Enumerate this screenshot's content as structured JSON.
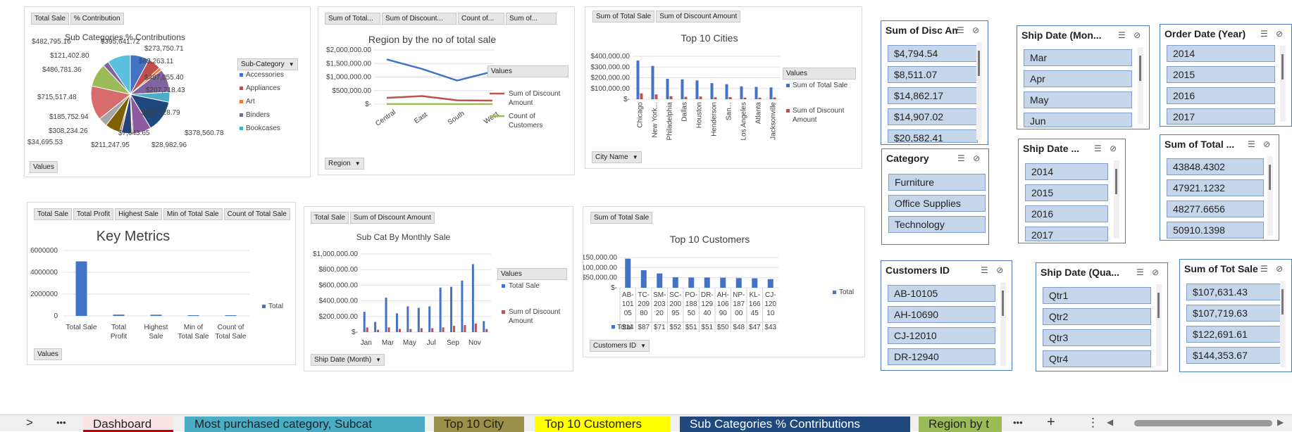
{
  "pie": {
    "buttons": [
      "Total Sale",
      "% Contribution"
    ],
    "title": "Sub Categories % Contributions",
    "legend_header": "Sub-Category",
    "legend": [
      "Accessories",
      "Appliances",
      "Art",
      "Binders",
      "Bookcases"
    ],
    "values_button": "Values",
    "labels": [
      "$482,795.16",
      "$395,641.72",
      "$273,750.71",
      "$121,402.80",
      "$63,263.11",
      "$486,781.36",
      "$487,055.40",
      "$207,718.43",
      "$715,517.48",
      "$662,428.79",
      "$185,752.94",
      "$308,234.26",
      "$7,643.65",
      "$378,560.78",
      "$34,695.53",
      "$211,247.95",
      "$28,982.96"
    ]
  },
  "region": {
    "buttons": [
      "Sum of Total...",
      "Sum of Discount...",
      "Count of...",
      "Sum of..."
    ],
    "title": "Region by the no of total sale",
    "legend_header": "Values",
    "axis_button": "Region",
    "legend": [
      "Sum of Total Sale",
      "Sum of Discount Amount",
      "Count of Customers"
    ]
  },
  "cities": {
    "buttons": [
      "Sum of Total Sale",
      "Sum of Discount Amount"
    ],
    "title": "Top 10 Cities",
    "legend_header": "Values",
    "axis_button": "City Name",
    "legend": [
      "Sum of Total Sale",
      "Sum of Discount Amount"
    ]
  },
  "metrics": {
    "buttons": [
      "Total Sale",
      "Total Profit",
      "Highest Sale",
      "Min of Total Sale",
      "Count of Total Sale"
    ],
    "title": "Key Metrics",
    "legend": "Total",
    "values_button": "Values"
  },
  "monthly": {
    "buttons": [
      "Total Sale",
      "Sum of Discount Amount"
    ],
    "title": "Sub Cat By Monthly Sale",
    "legend_header": "Values",
    "axis_button": "Ship Date (Month)",
    "legend": [
      "Total Sale",
      "Sum of Discount Amount"
    ]
  },
  "customers": {
    "buttons": [
      "Sum of Total  Sale"
    ],
    "title": "Top 10 Customers",
    "legend": "Total",
    "axis_button": "Customers ID",
    "table_label": "Total"
  },
  "chart_data": [
    {
      "type": "pie",
      "title": "Sub Categories % Contributions",
      "legend": [
        "Accessories",
        "Appliances",
        "Art",
        "Binders",
        "Bookcases"
      ],
      "values": [
        395641.72,
        273750.71,
        63263.11,
        487055.4,
        207718.43,
        662428.79,
        378560.78,
        28982.96,
        211247.95,
        7643.65,
        34695.53,
        308234.26,
        185752.94,
        715517.48,
        486781.36,
        121402.8,
        482795.16
      ],
      "colors": [
        "#4472c4",
        "#c0504d",
        "#ed7d31",
        "#8064a2",
        "#4bacc6",
        "#1f497d",
        "#8e5aa2",
        "#e46c0a",
        "#264478",
        "#ffc000",
        "#9b2335",
        "#7f6000",
        "#a5a5a5",
        "#d86c6c",
        "#9bbb59",
        "#8064a2",
        "#5bc0de"
      ]
    },
    {
      "type": "line",
      "title": "Region by the no of total sale",
      "categories": [
        "Central",
        "East",
        "South",
        "West"
      ],
      "ylim": [
        0,
        2000000
      ],
      "yticks": [
        "$2,000,000.00",
        "$1,500,000.00",
        "$1,000,000.00",
        "$500,000.00",
        "$-"
      ],
      "series": [
        {
          "name": "Sum of Total Sale",
          "color": "#4472c4",
          "values": [
            1650000,
            1300000,
            870000,
            1200000
          ]
        },
        {
          "name": "Sum of Discount Amount",
          "color": "#c0504d",
          "values": [
            230000,
            300000,
            140000,
            130000
          ]
        },
        {
          "name": "Count of Customers",
          "color": "#9bbb59",
          "values": [
            2000,
            2500,
            1500,
            3000
          ]
        }
      ]
    },
    {
      "type": "bar",
      "title": "Top 10 Cities",
      "categories": [
        "Chicago",
        "New York...",
        "Philadelphia",
        "Dallas",
        "Houston",
        "Henderson",
        "San...",
        "Los Angeles",
        "Atlanta",
        "Jacksonville"
      ],
      "ylim": [
        0,
        400000
      ],
      "yticks": [
        "$400,000.00",
        "$300,000.00",
        "$200,000.00",
        "$100,000.00",
        "$-"
      ],
      "series": [
        {
          "name": "Sum of Total Sale",
          "color": "#4472c4",
          "values": [
            360000,
            310000,
            190000,
            185000,
            175000,
            150000,
            140000,
            120000,
            115000,
            110000
          ]
        },
        {
          "name": "Sum of Discount Amount",
          "color": "#c0504d",
          "values": [
            55000,
            45000,
            28000,
            22000,
            25000,
            18000,
            20000,
            15000,
            14000,
            16000
          ]
        }
      ]
    },
    {
      "type": "bar",
      "title": "Key Metrics",
      "categories": [
        "Total Sale",
        "Total Profit",
        "Highest Sale",
        "Min of Total Sale",
        "Count of Total Sale"
      ],
      "ylim": [
        0,
        6000000
      ],
      "yticks": [
        "6000000",
        "4000000",
        "2000000",
        "0"
      ],
      "series": [
        {
          "name": "Total",
          "color": "#4472c4",
          "values": [
            5000000,
            120000,
            110000,
            0,
            0
          ]
        }
      ]
    },
    {
      "type": "bar",
      "title": "Sub Cat By Monthly Sale",
      "categories": [
        "Jan",
        "Feb",
        "Mar",
        "Apr",
        "May",
        "Jun",
        "Jul",
        "Aug",
        "Sep",
        "Oct",
        "Nov",
        "Dec"
      ],
      "xticks_shown": [
        "Jan",
        "Mar",
        "May",
        "Jul",
        "Sep",
        "Nov"
      ],
      "ylim": [
        0,
        1000000
      ],
      "yticks": [
        "$1,000,000.00",
        "$800,000.00",
        "$600,000.00",
        "$400,000.00",
        "$200,000.00",
        "$-"
      ],
      "series": [
        {
          "name": "Total Sale",
          "color": "#4472c4",
          "values": [
            260000,
            130000,
            440000,
            240000,
            330000,
            310000,
            330000,
            570000,
            580000,
            660000,
            870000,
            140000
          ]
        },
        {
          "name": "Sum of Discount Amount",
          "color": "#c0504d",
          "values": [
            60000,
            30000,
            60000,
            40000,
            40000,
            50000,
            50000,
            60000,
            80000,
            90000,
            110000,
            40000
          ]
        }
      ]
    },
    {
      "type": "bar",
      "title": "Top 10 Customers",
      "categories": [
        "AB-10105",
        "TC-20980",
        "SM-20320",
        "SC-20095",
        "PO-18850",
        "DR-12940",
        "AH-10690",
        "NP-18700",
        "KL-16645",
        "CJ-12010"
      ],
      "ylim": [
        0,
        150000
      ],
      "yticks": [
        "$150,000.00",
        "$100,000.00",
        "$50,000.00",
        "$-"
      ],
      "series": [
        {
          "name": "Total",
          "color": "#4472c4",
          "values": [
            144353.67,
            87000,
            71000,
            52000,
            51000,
            51000,
            50000,
            48000,
            47000,
            43000
          ]
        }
      ],
      "table_values": [
        "$14",
        "$87",
        "$71",
        "$52",
        "$51",
        "$51",
        "$50",
        "$48",
        "$47",
        "$43"
      ]
    }
  ],
  "slicers": {
    "disc_amt": {
      "title": "Sum of Disc Amt",
      "items": [
        "$4,794.54",
        "$8,511.07",
        "$14,862.17",
        "$14,907.02",
        "$20,582.41"
      ]
    },
    "ship_month": {
      "title": "Ship Date (Mon...",
      "items": [
        "Mar",
        "Apr",
        "May",
        "Jun"
      ]
    },
    "order_year": {
      "title": "Order Date (Year)",
      "items": [
        "2014",
        "2015",
        "2016",
        "2017"
      ]
    },
    "category": {
      "title": "Category",
      "items": [
        "Furniture",
        "Office Supplies",
        "Technology"
      ]
    },
    "ship_year": {
      "title": "Ship Date ...",
      "items": [
        "2014",
        "2015",
        "2016",
        "2017"
      ]
    },
    "sum_total": {
      "title": "Sum of Total ...",
      "items": [
        "43848.4302",
        "47921.1232",
        "48277.6656",
        "50910.1398"
      ]
    },
    "customers": {
      "title": "Customers ID",
      "items": [
        "AB-10105",
        "AH-10690",
        "CJ-12010",
        "DR-12940"
      ]
    },
    "ship_quarter": {
      "title": "Ship Date (Qua...",
      "items": [
        "Qtr1",
        "Qtr2",
        "Qtr3",
        "Qtr4"
      ]
    },
    "tot_sale": {
      "title": "Sum of Tot Sale",
      "items": [
        "$107,631.43",
        "$107,719.63",
        "$122,691.61",
        "$144,353.67"
      ]
    }
  },
  "tabs": {
    "nav_next": ">",
    "more": "•••",
    "sheets": [
      {
        "label": "Dashboard",
        "color": "#f8d7da",
        "active": true
      },
      {
        "label": "Most purchased category, Subcat",
        "color": "#4bacc6"
      },
      {
        "label": "Top 10 City",
        "color": "#9c8f4a"
      },
      {
        "label": "Top 10 Customers",
        "color": "#ffff00"
      },
      {
        "label": "Sub Categories % Contributions",
        "color": "#1f497d"
      },
      {
        "label": "Region by t",
        "color": "#9bbb59"
      }
    ],
    "more_right": "•••",
    "add": "+",
    "options": "⋮",
    "scroll_left": "◀",
    "scroll_right": "▶"
  }
}
